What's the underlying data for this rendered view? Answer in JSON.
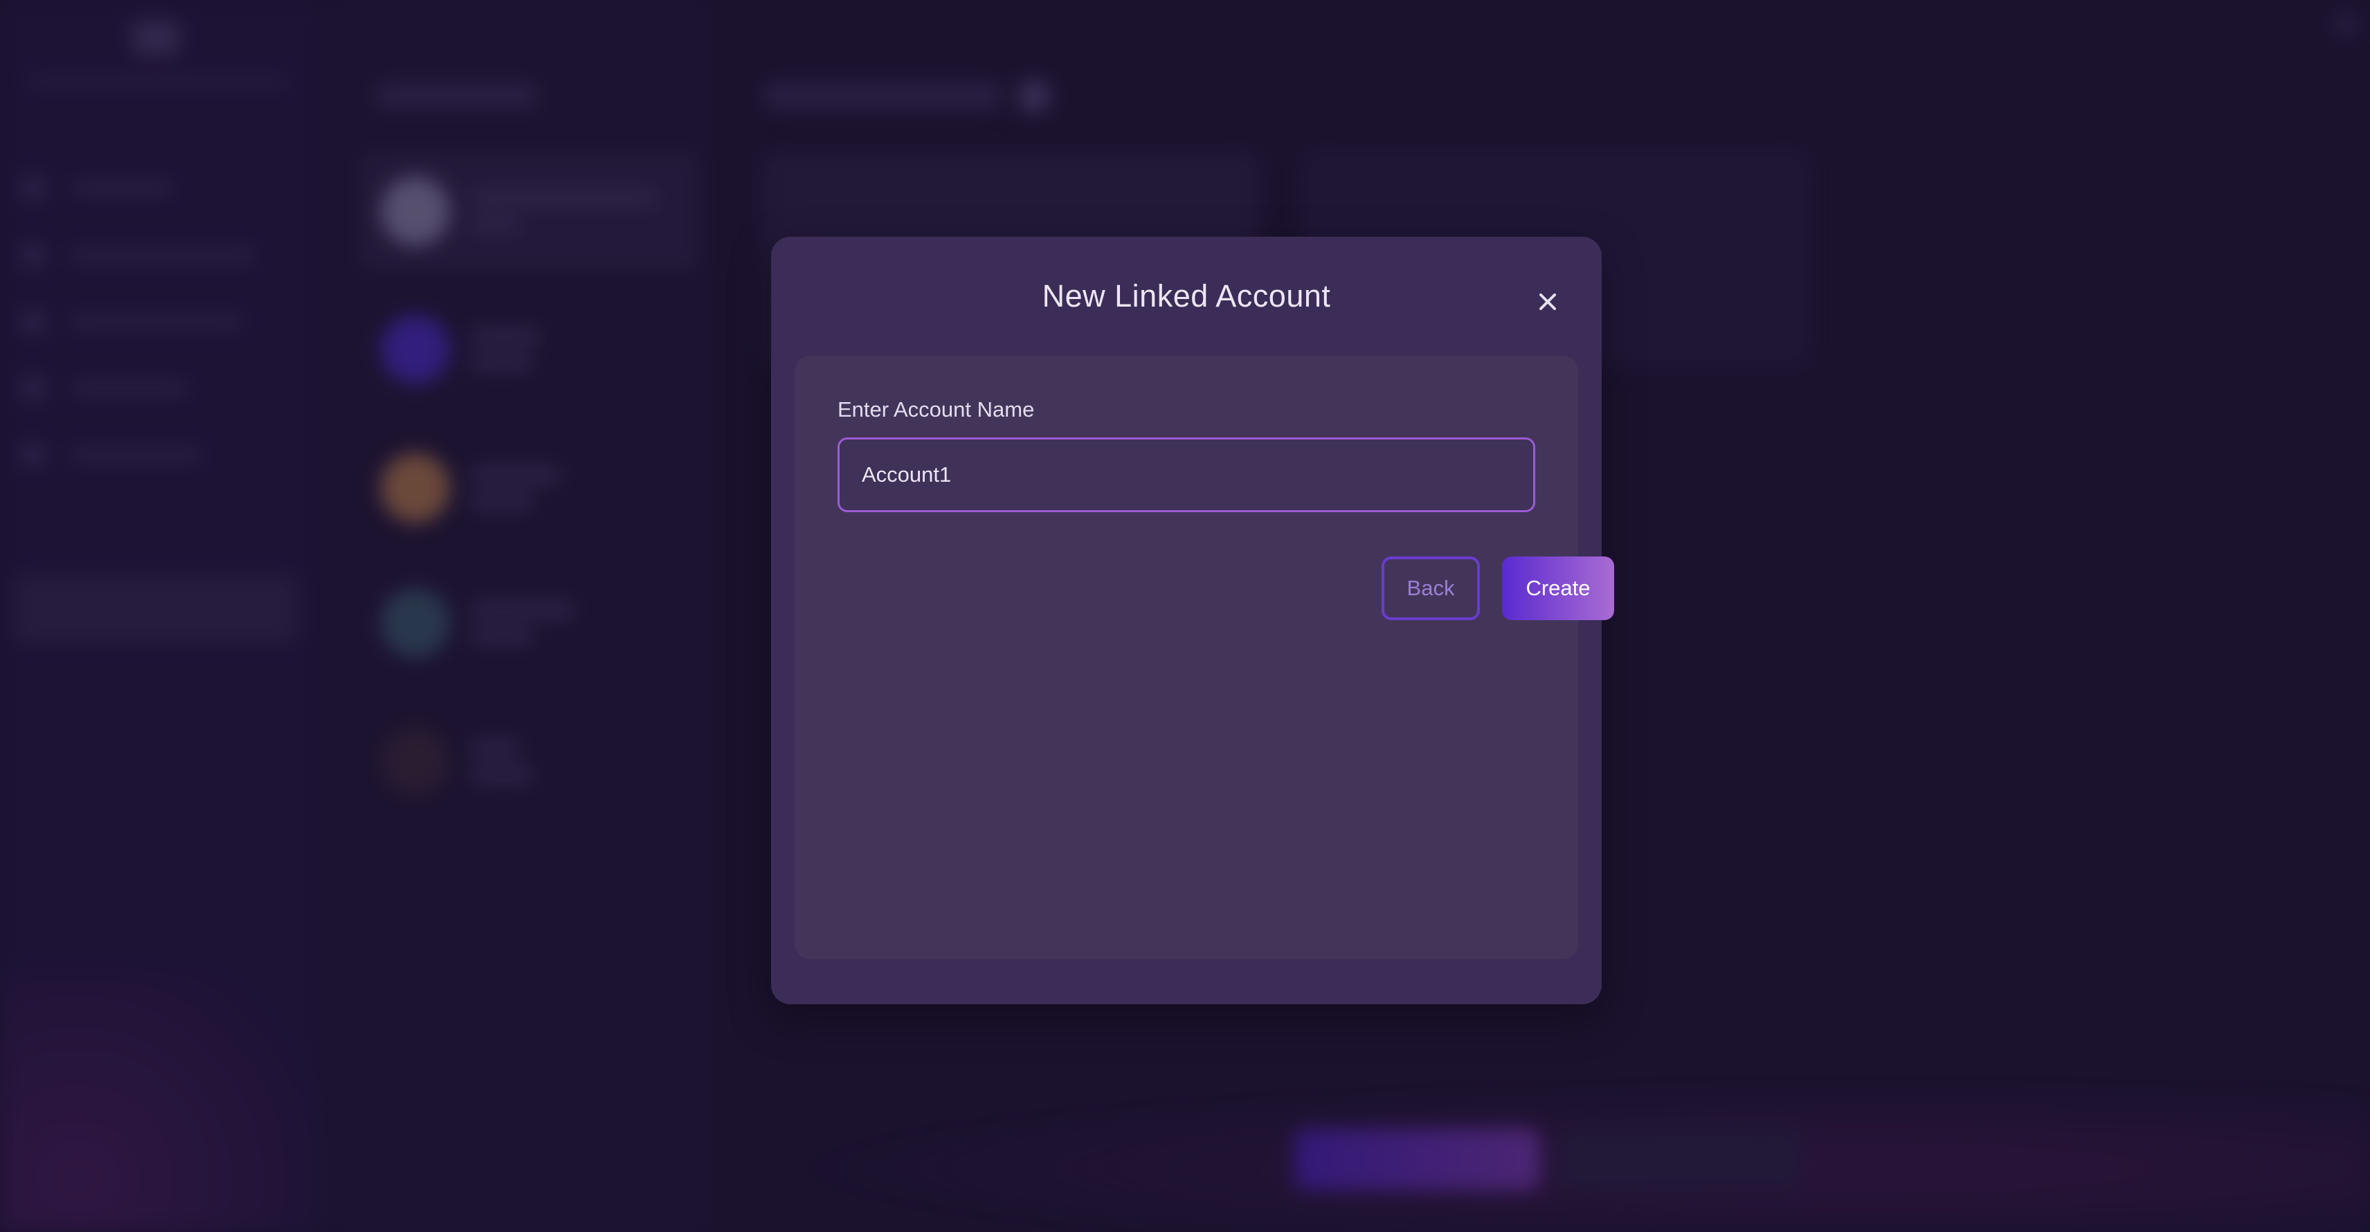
{
  "modal": {
    "title": "New Linked Account",
    "field_label": "Enter Account Name",
    "input_value": "Account1",
    "back_label": "Back",
    "create_label": "Create"
  },
  "colors": {
    "background": "#1f1634",
    "modal_bg": "#3b2d57",
    "modal_body_bg": "#433559",
    "input_border": "#9a5bd6",
    "back_border": "#6a3cd0",
    "create_gradient_start": "#5a2ad0",
    "create_gradient_end": "#a96cd2"
  },
  "icons": {
    "close": "close-icon"
  }
}
